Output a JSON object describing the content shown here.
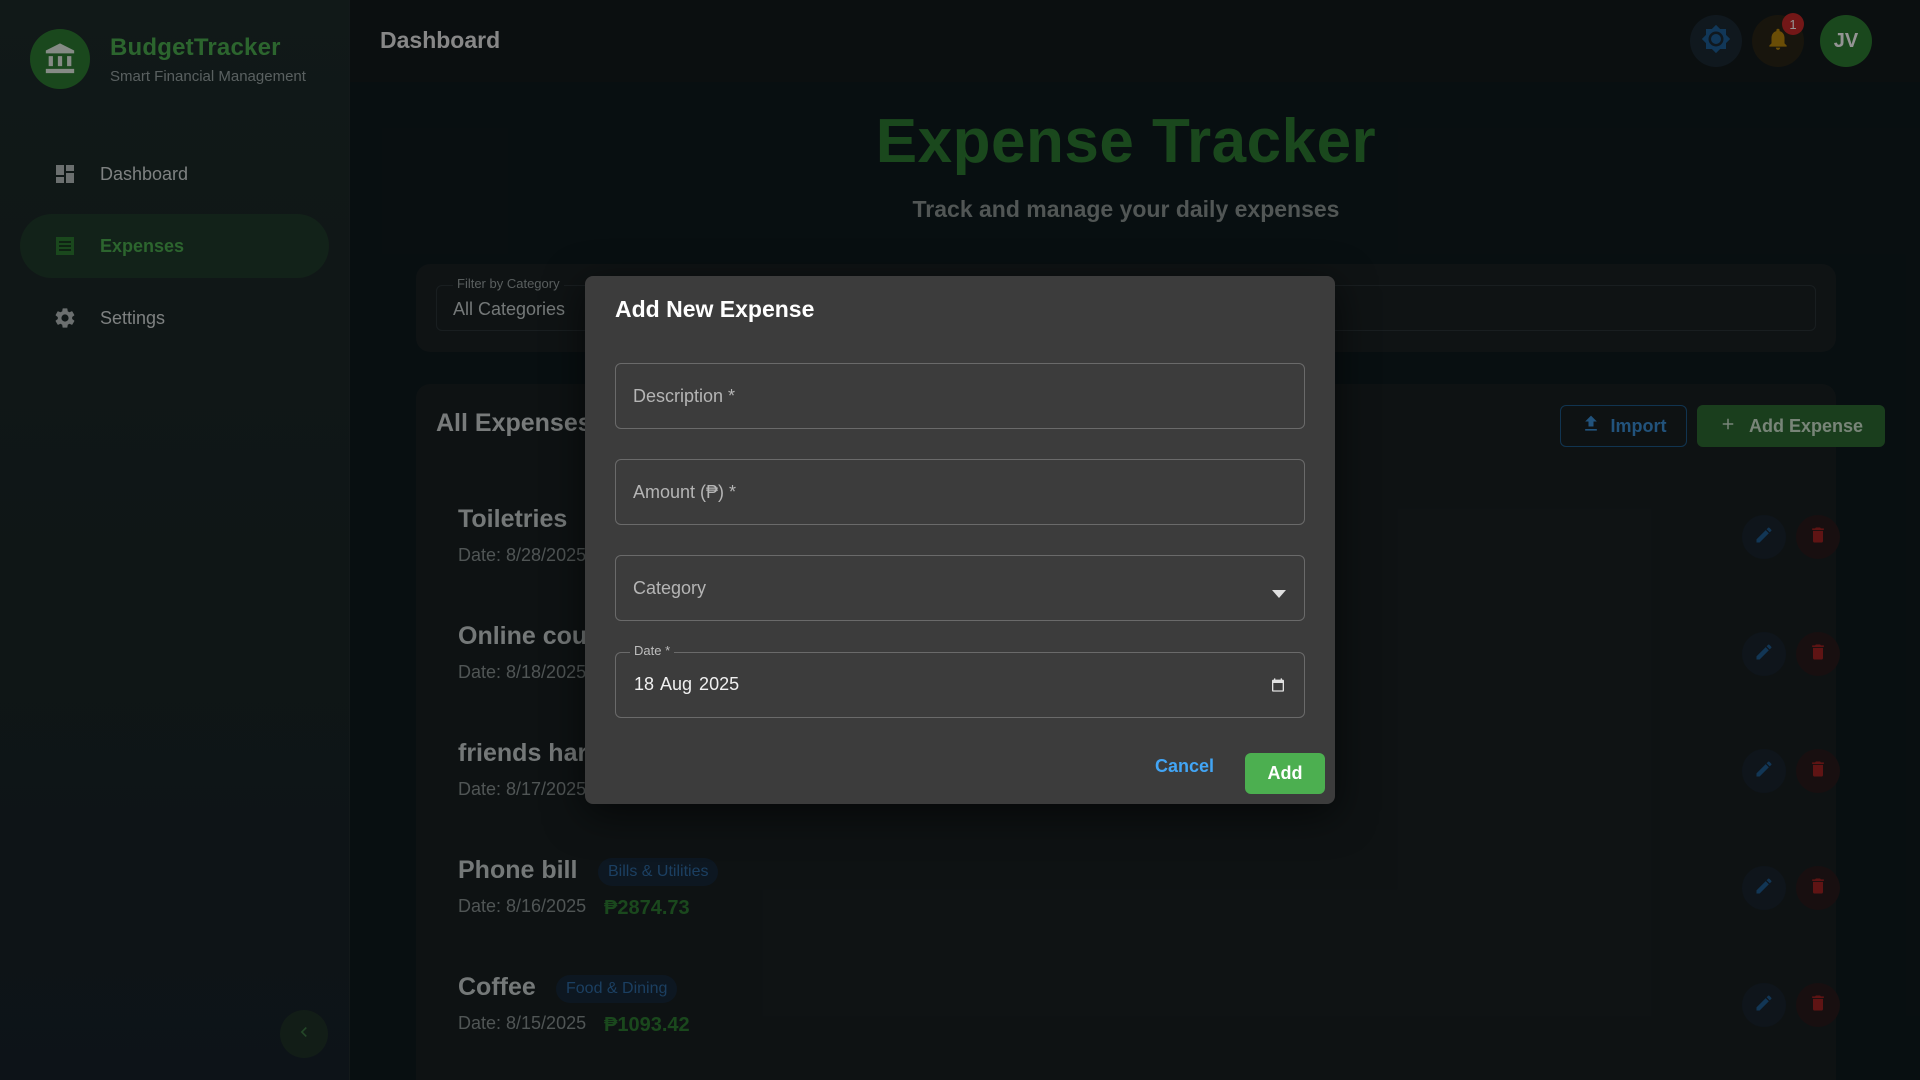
{
  "brand": {
    "name": "BudgetTracker",
    "tagline": "Smart Financial Management"
  },
  "sidebar": {
    "items": [
      {
        "label": "Dashboard",
        "icon": "dashboard-icon",
        "active": false
      },
      {
        "label": "Expenses",
        "icon": "receipt-icon",
        "active": true
      },
      {
        "label": "Settings",
        "icon": "gear-icon",
        "active": false
      }
    ]
  },
  "topbar": {
    "title": "Dashboard",
    "notification_count": "1",
    "avatar_initials": "JV"
  },
  "page": {
    "title": "Expense Tracker",
    "subtitle": "Track and manage your daily expenses"
  },
  "filter": {
    "label": "Filter by Category",
    "value": "All Categories"
  },
  "expenses": {
    "title": "All Expenses",
    "import_label": "Import",
    "add_label": "Add Expense",
    "rows": [
      {
        "name": "Toiletries",
        "category": "",
        "date": "Date: 8/28/2025",
        "amount": ""
      },
      {
        "name": "Online cou",
        "category": "",
        "date": "Date: 8/18/2025",
        "amount": ""
      },
      {
        "name": "friends har",
        "category": "",
        "date": "Date: 8/17/2025",
        "amount": ""
      },
      {
        "name": "Phone bill",
        "category": "Bills & Utilities",
        "date": "Date: 8/16/2025",
        "amount": "₱2874.73"
      },
      {
        "name": "Coffee",
        "category": "Food & Dining",
        "date": "Date: 8/15/2025",
        "amount": "₱1093.42"
      }
    ]
  },
  "dialog": {
    "title": "Add New Expense",
    "description_placeholder": "Description *",
    "amount_placeholder": "Amount (₱) *",
    "category_placeholder": "Category",
    "date_label": "Date *",
    "date_value": "18 Aug 2025",
    "cancel_label": "Cancel",
    "add_label": "Add"
  },
  "colors": {
    "accent": "#4caf50",
    "brand_green": "#2e7d32",
    "link_blue": "#42a5f5",
    "danger": "#c62828"
  }
}
